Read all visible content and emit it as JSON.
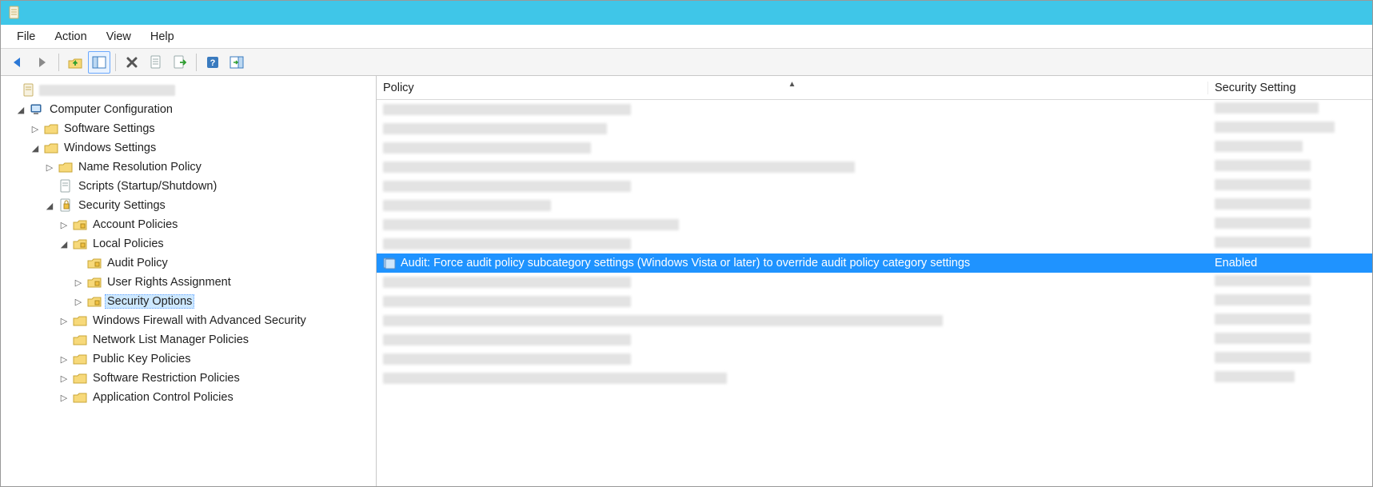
{
  "menubar": {
    "file": "File",
    "action": "Action",
    "view": "View",
    "help": "Help"
  },
  "toolbar": {
    "back": "back-icon",
    "forward": "forward-icon",
    "up": "up-one-level-icon",
    "show_hide_tree": "show-hide-tree-icon",
    "delete": "delete-icon",
    "properties": "properties-icon",
    "export": "export-list-icon",
    "help": "help-icon",
    "action_pane": "show-hide-action-pane-icon"
  },
  "tree": {
    "root_blurred": true,
    "computer_configuration": "Computer Configuration",
    "software_settings": "Software Settings",
    "windows_settings": "Windows Settings",
    "name_resolution_policy": "Name Resolution Policy",
    "scripts": "Scripts (Startup/Shutdown)",
    "security_settings": "Security Settings",
    "account_policies": "Account Policies",
    "local_policies": "Local Policies",
    "audit_policy": "Audit Policy",
    "user_rights_assignment": "User Rights Assignment",
    "security_options": "Security Options",
    "windows_firewall": "Windows Firewall with Advanced Security",
    "network_list_manager": "Network List Manager Policies",
    "public_key_policies": "Public Key Policies",
    "software_restriction_policies": "Software Restriction Policies",
    "application_control_policies": "Application Control Policies"
  },
  "list": {
    "columns": {
      "policy": "Policy",
      "security_setting": "Security Setting"
    },
    "selected_row": {
      "policy": "Audit: Force audit policy subcategory settings (Windows Vista or later) to override audit policy category settings",
      "setting": "Enabled"
    }
  }
}
